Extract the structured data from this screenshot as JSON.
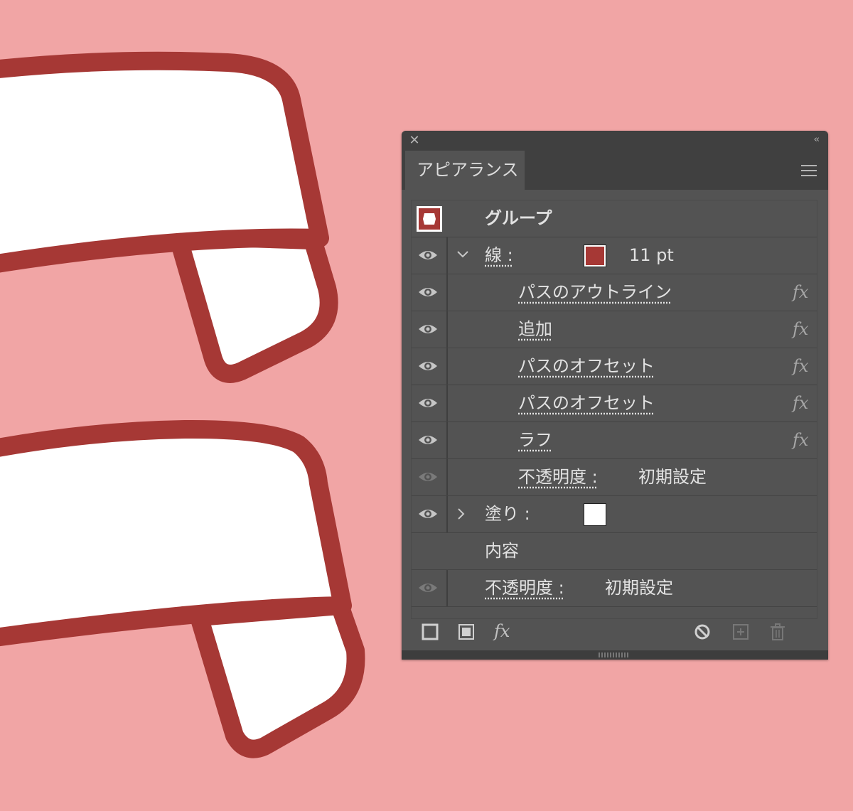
{
  "canvas": {
    "background": "#f1a5a5",
    "ribbon_stroke": "#a63835",
    "ribbon_fill": "#ffffff"
  },
  "panel": {
    "tab_label": "アピアランス",
    "header": {
      "label": "グループ"
    },
    "stroke": {
      "label": "線 :",
      "color": "#a63835",
      "weight": "11 pt"
    },
    "effects": [
      {
        "label": "パスのアウトライン",
        "icon": "fx-icon",
        "fx": "fx"
      },
      {
        "label": "追加",
        "icon": "fx-icon",
        "fx": "fx"
      },
      {
        "label": "パスのオフセット",
        "icon": "fx-icon",
        "fx": "fx"
      },
      {
        "label": "パスのオフセット",
        "icon": "fx-icon",
        "fx": "fx"
      },
      {
        "label": "ラフ",
        "icon": "fx-icon",
        "fx": "fx"
      }
    ],
    "stroke_opacity": {
      "label": "不透明度 :",
      "value": "初期設定"
    },
    "fill": {
      "label": "塗り :",
      "color": "#ffffff"
    },
    "contents": {
      "label": "内容"
    },
    "opacity": {
      "label": "不透明度 :",
      "value": "初期設定"
    },
    "footer": {
      "add_stroke_icon": "add-new-stroke-icon",
      "add_fill_icon": "add-new-fill-icon",
      "fx_label": "fx",
      "clear_icon": "clear-appearance-icon",
      "duplicate_icon": "duplicate-item-icon",
      "delete_icon": "trash-icon"
    }
  }
}
